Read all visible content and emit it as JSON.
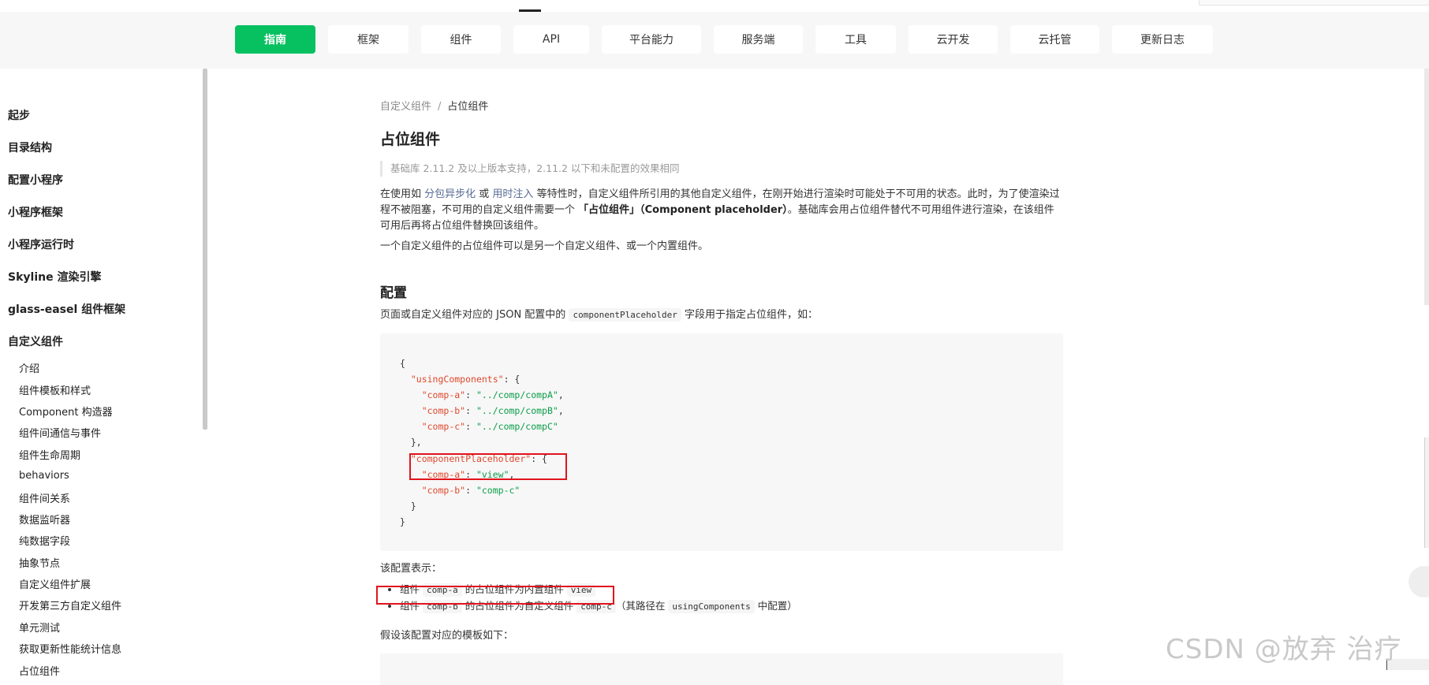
{
  "nav": {
    "items": [
      {
        "label": "指南",
        "active": true
      },
      {
        "label": "框架",
        "active": false
      },
      {
        "label": "组件",
        "active": false
      },
      {
        "label": "API",
        "active": false
      },
      {
        "label": "平台能力",
        "active": false
      },
      {
        "label": "服务端",
        "active": false
      },
      {
        "label": "工具",
        "active": false
      },
      {
        "label": "云开发",
        "active": false
      },
      {
        "label": "云托管",
        "active": false
      },
      {
        "label": "更新日志",
        "active": false
      }
    ],
    "accent_color": "#07c160"
  },
  "sidebar": {
    "top_items": [
      "起步",
      "目录结构",
      "配置小程序",
      "小程序框架",
      "小程序运行时",
      "Skyline 渲染引擎",
      "glass-easel 组件框架",
      "自定义组件"
    ],
    "sub_items": [
      "介绍",
      "组件模板和样式",
      "Component 构造器",
      "组件间通信与事件",
      "组件生命周期",
      "behaviors",
      "组件间关系",
      "数据监听器",
      "纯数据字段",
      "抽象节点",
      "自定义组件扩展",
      "开发第三方自定义组件",
      "单元测试",
      "获取更新性能统计信息",
      "占位组件"
    ]
  },
  "breadcrumb": {
    "parent": "自定义组件",
    "sep": "/",
    "current": "占位组件"
  },
  "title": "占位组件",
  "note": "基础库 2.11.2 及以上版本支持，2.11.2 以下和未配置的效果相同",
  "p1": {
    "t1": "在使用如 ",
    "link1": "分包异步化",
    "t2": " 或 ",
    "link2": "用时注入",
    "t3": " 等特性时，自定义组件所引用的其他自定义组件，在刚开始进行渲染时可能处于不可用的状态。此时，为了使渲染过程不被阻塞，不可用的自定义组件需要一个 ",
    "bold": "「占位组件」（Component placeholder）",
    "t4": "。基础库会用占位组件替代不可用组件进行渲染，在该组件可用后再将占位组件替换回该组件。"
  },
  "p2": "一个自定义组件的占位组件可以是另一个自定义组件、或一个内置组件。",
  "h2": "配置",
  "p3": {
    "t1": "页面或自定义组件对应的 JSON 配置中的 ",
    "code": "componentPlaceholder",
    "t2": " 字段用于指定占位组件，如："
  },
  "code": {
    "open": "{",
    "uc_key": "\"usingComponents\"",
    "comp_a": "\"comp-a\"",
    "comp_a_val": "\"../comp/compA\"",
    "comp_b": "\"comp-b\"",
    "comp_b_val": "\"../comp/compB\"",
    "comp_c": "\"comp-c\"",
    "comp_c_val": "\"../comp/compC\"",
    "close_obj": "},",
    "cp_key": "\"componentPlaceholder\"",
    "cp_a": "\"comp-a\"",
    "cp_a_val": "\"view\"",
    "cp_b": "\"comp-b\"",
    "cp_b_val": "\"comp-c\"",
    "inner_close": "}",
    "close": "}"
  },
  "p4": "该配置表示：",
  "bullets": [
    {
      "t1": "组件 ",
      "c1": "comp-a",
      "t2": " 的占位组件为内置组件 ",
      "c2": "view"
    },
    {
      "t1": "组件 ",
      "c1": "comp-b",
      "t2": " 的占位组件为自定义组件 ",
      "c2": "comp-c",
      "t3": "（其路径在 ",
      "c3": "usingComponents",
      "t4": " 中配置）"
    }
  ],
  "p5": "假设该配置对应的模板如下：",
  "watermark": "CSDN @放弃      治疗"
}
